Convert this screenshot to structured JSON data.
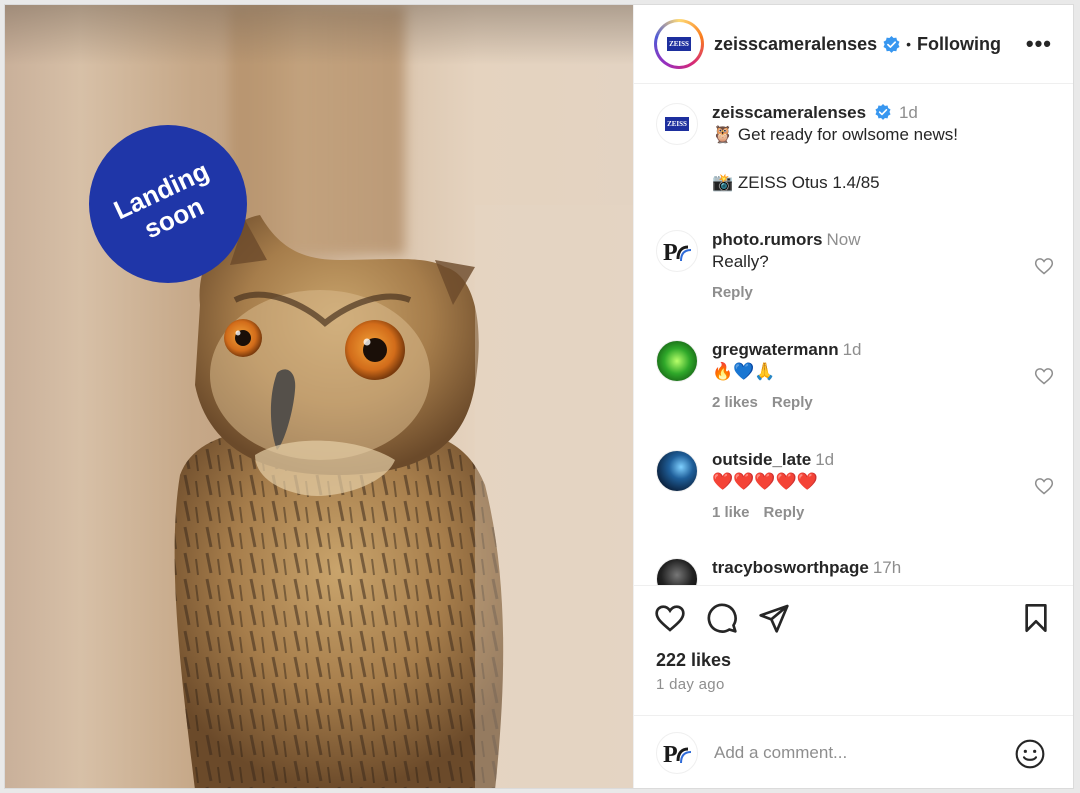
{
  "badge": {
    "text": "Landing\nsoon",
    "color": "#1f36a8"
  },
  "header": {
    "username": "zeisscameralenses",
    "verified": true,
    "separator": "•",
    "follow_state": "Following",
    "more_label": "•••"
  },
  "avatar_logo_text": "ZEISS",
  "caption": {
    "username": "zeisscameralenses",
    "time": "1d",
    "line1": "🦉 Get ready for owlsome news!",
    "line2": "📸 ZEISS Otus 1.4/85"
  },
  "comments": [
    {
      "username": "photo.rumors",
      "time": "Now",
      "text": "Really?",
      "likes": "",
      "reply": "Reply"
    },
    {
      "username": "gregwatermann",
      "time": "1d",
      "text": "🔥💙🙏",
      "likes": "2 likes",
      "reply": "Reply"
    },
    {
      "username": "outside_late",
      "time": "1d",
      "text": "❤️❤️❤️❤️❤️",
      "likes": "1 like",
      "reply": "Reply"
    },
    {
      "username": "tracybosworthpage",
      "time": "17h"
    }
  ],
  "actions": {
    "like_icon": "heart-icon",
    "comment_icon": "comment-icon",
    "share_icon": "paper-plane-icon",
    "save_icon": "bookmark-icon"
  },
  "likes_count": "222 likes",
  "posted_ago": "1 day ago",
  "add_comment": {
    "placeholder": "Add a comment...",
    "emoji_icon": "smiley-icon"
  },
  "colors": {
    "link_blue": "#0095f6",
    "verified": "#3897f0",
    "muted": "#8e8e8e"
  }
}
